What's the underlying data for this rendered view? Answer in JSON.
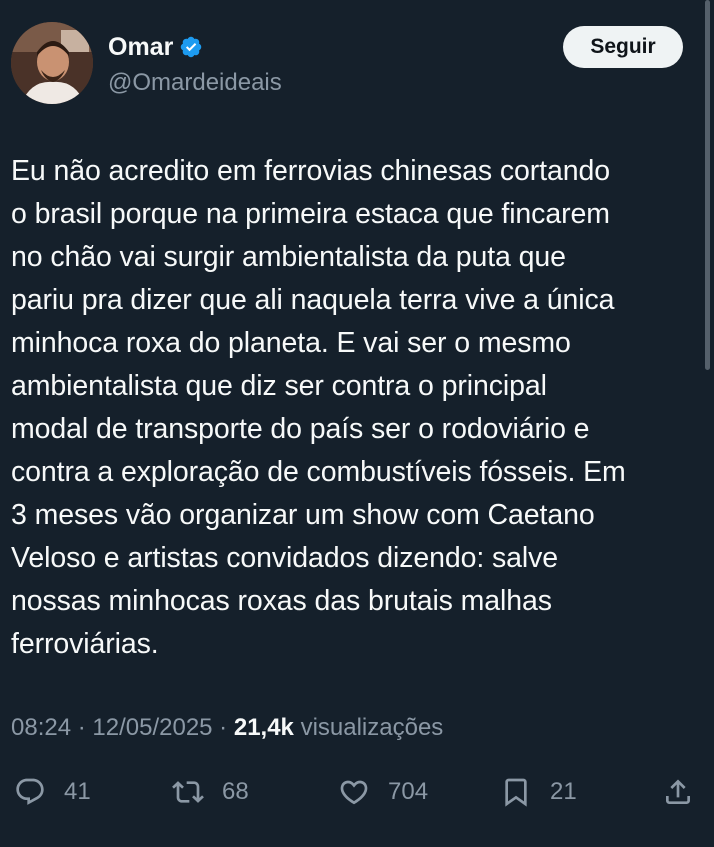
{
  "author": {
    "name": "Omar",
    "handle": "@Omardeideais",
    "verified": true
  },
  "follow_button": {
    "label": "Seguir"
  },
  "tweet": {
    "lines": [
      "Eu não acredito em ferrovias chinesas cortando",
      "o brasil porque na primeira estaca que fincarem",
      "no chão vai surgir ambientalista da puta que",
      "pariu pra dizer que ali naquela terra vive a única",
      "minhoca roxa do planeta. E vai ser o mesmo",
      "ambientalista que diz ser contra o principal",
      "modal de transporte do país ser o rodoviário e",
      "contra a exploração de combustíveis fósseis. Em",
      "3 meses vão organizar um show com Caetano",
      "Veloso e artistas convidados dizendo: salve",
      "nossas minhocas roxas das brutais malhas",
      "ferroviárias."
    ]
  },
  "meta": {
    "time": "08:24",
    "separator": " · ",
    "date": "12/05/2025",
    "views_count": "21,4k",
    "views_label": " visualizações"
  },
  "actions": {
    "replies": "41",
    "reposts": "68",
    "likes": "704",
    "bookmarks": "21"
  },
  "colors": {
    "background": "#15202b",
    "text": "#f7f9f9",
    "secondary": "#8b98a5",
    "verified": "#1d9bf0"
  }
}
